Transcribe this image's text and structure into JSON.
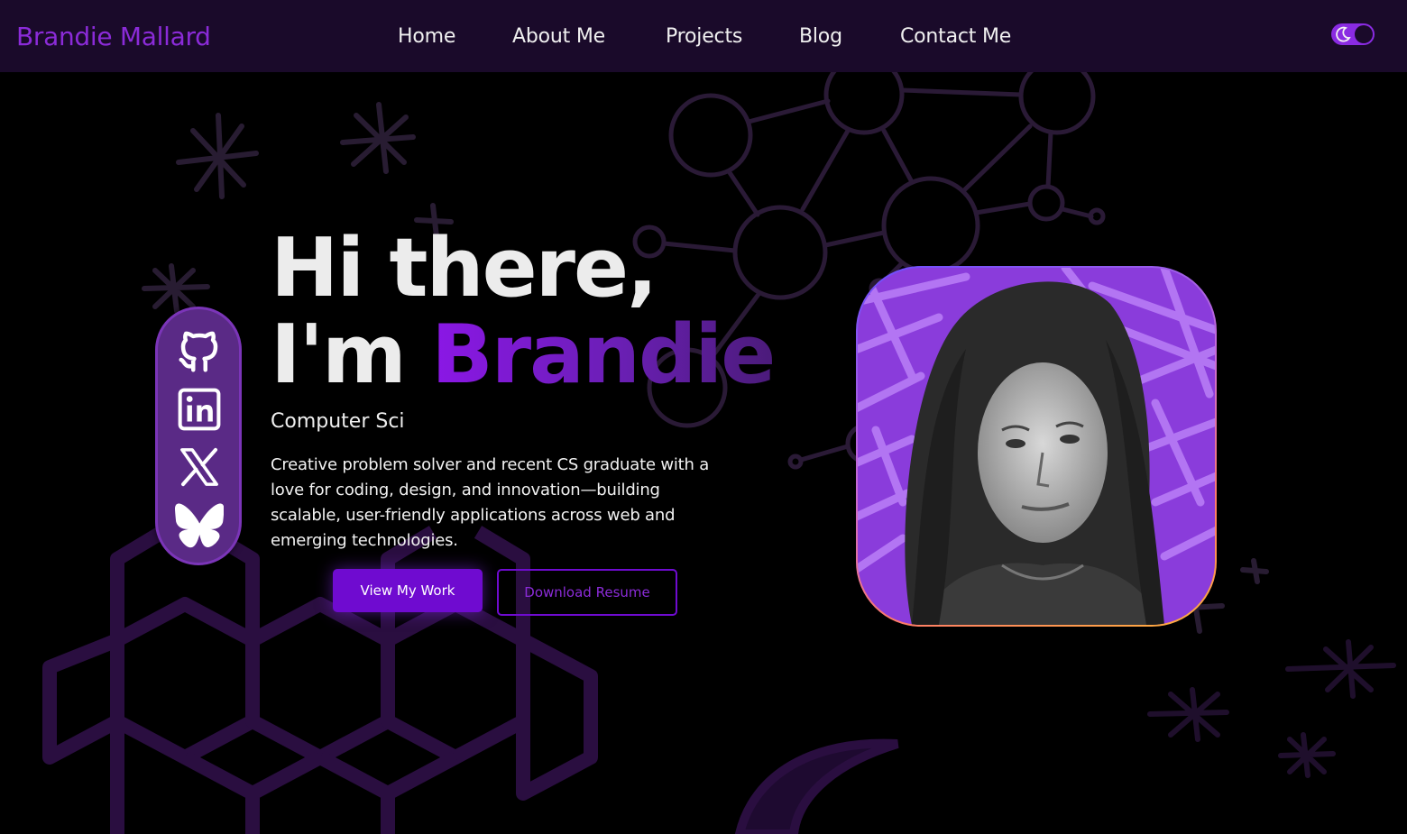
{
  "navbar": {
    "brand": "Brandie Mallard",
    "links": [
      {
        "label": "Home"
      },
      {
        "label": "About Me"
      },
      {
        "label": "Projects"
      },
      {
        "label": "Blog"
      },
      {
        "label": "Contact Me"
      }
    ],
    "theme_toggle_icon": "moon-icon"
  },
  "hero": {
    "greeting_line1": "Hi there,",
    "greeting_prefix": "I'm ",
    "name": "Brandie",
    "subtitle": "Computer Sci",
    "description": "Creative problem solver and recent CS graduate with a love for coding, design, and innovation—building scalable, user-friendly applications across web and emerging technologies.",
    "primary_button": "View My Work",
    "secondary_button": "Download Resume"
  },
  "social": [
    {
      "icon": "github-icon"
    },
    {
      "icon": "linkedin-icon"
    },
    {
      "icon": "x-icon"
    },
    {
      "icon": "bluesky-icon"
    }
  ],
  "portrait": {
    "icon": "profile-photo"
  },
  "colors": {
    "accent": "#8b2bd8",
    "navbar_bg": "#1a0a2a",
    "primary_button": "#6f0bd0",
    "social_rail": "#5a2a86",
    "page_bg": "#000000"
  }
}
